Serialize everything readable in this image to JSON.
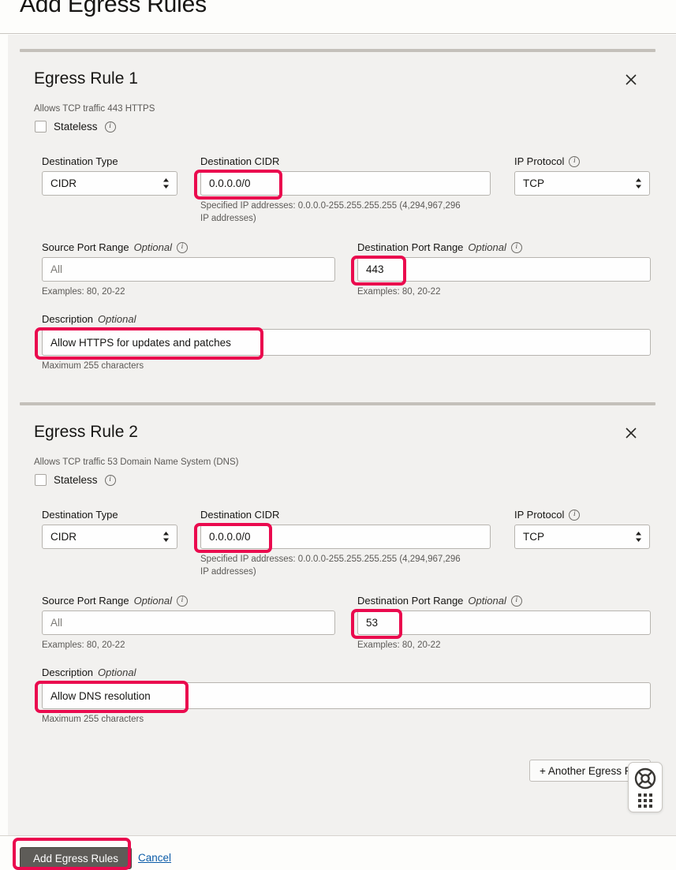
{
  "header": {
    "title": "Add Egress Rules"
  },
  "icons": {
    "close": "close-icon",
    "info": "info-icon",
    "chevron": "chevron-updown-icon",
    "help": "lifebuoy-icon",
    "apps": "app-grid-icon"
  },
  "colors": {
    "highlight": "#ea0a4e",
    "panel_bg": "#f2f1ef",
    "page_bg": "#fdfdfb",
    "primary_button": "#5e5c58",
    "link": "#0b5ca8"
  },
  "rules": [
    {
      "title": "Egress Rule 1",
      "subtitle": "Allows TCP traffic 443 HTTPS",
      "stateless_label": "Stateless",
      "stateless_checked": false,
      "destination_type": {
        "label": "Destination Type",
        "value": "CIDR"
      },
      "destination_cidr": {
        "label": "Destination CIDR",
        "value": "0.0.0.0/0",
        "helper": "Specified IP addresses: 0.0.0.0-255.255.255.255 (4,294,967,296 IP addresses)"
      },
      "ip_protocol": {
        "label": "IP Protocol",
        "value": "TCP"
      },
      "source_port_range": {
        "label": "Source Port Range",
        "optional": "Optional",
        "value": "",
        "placeholder": "All",
        "helper": "Examples: 80, 20-22"
      },
      "destination_port_range": {
        "label": "Destination Port Range",
        "optional": "Optional",
        "value": "443",
        "helper": "Examples: 80, 20-22"
      },
      "description": {
        "label": "Description",
        "optional": "Optional",
        "value": "Allow HTTPS for updates and patches",
        "helper": "Maximum 255 characters"
      }
    },
    {
      "title": "Egress Rule 2",
      "subtitle": "Allows TCP traffic 53 Domain Name System (DNS)",
      "stateless_label": "Stateless",
      "stateless_checked": false,
      "destination_type": {
        "label": "Destination Type",
        "value": "CIDR"
      },
      "destination_cidr": {
        "label": "Destination CIDR",
        "value": "0.0.0.0/0",
        "helper": "Specified IP addresses: 0.0.0.0-255.255.255.255 (4,294,967,296 IP addresses)"
      },
      "ip_protocol": {
        "label": "IP Protocol",
        "value": "TCP"
      },
      "source_port_range": {
        "label": "Source Port Range",
        "optional": "Optional",
        "value": "",
        "placeholder": "All",
        "helper": "Examples: 80, 20-22"
      },
      "destination_port_range": {
        "label": "Destination Port Range",
        "optional": "Optional",
        "value": "53",
        "helper": "Examples: 80, 20-22"
      },
      "description": {
        "label": "Description",
        "optional": "Optional",
        "value": "Allow DNS resolution",
        "helper": "Maximum 255 characters"
      }
    }
  ],
  "another_rule_button": {
    "label": "+ Another Egress Rule"
  },
  "footer": {
    "submit_label": "Add Egress Rules",
    "cancel_label": "Cancel"
  }
}
